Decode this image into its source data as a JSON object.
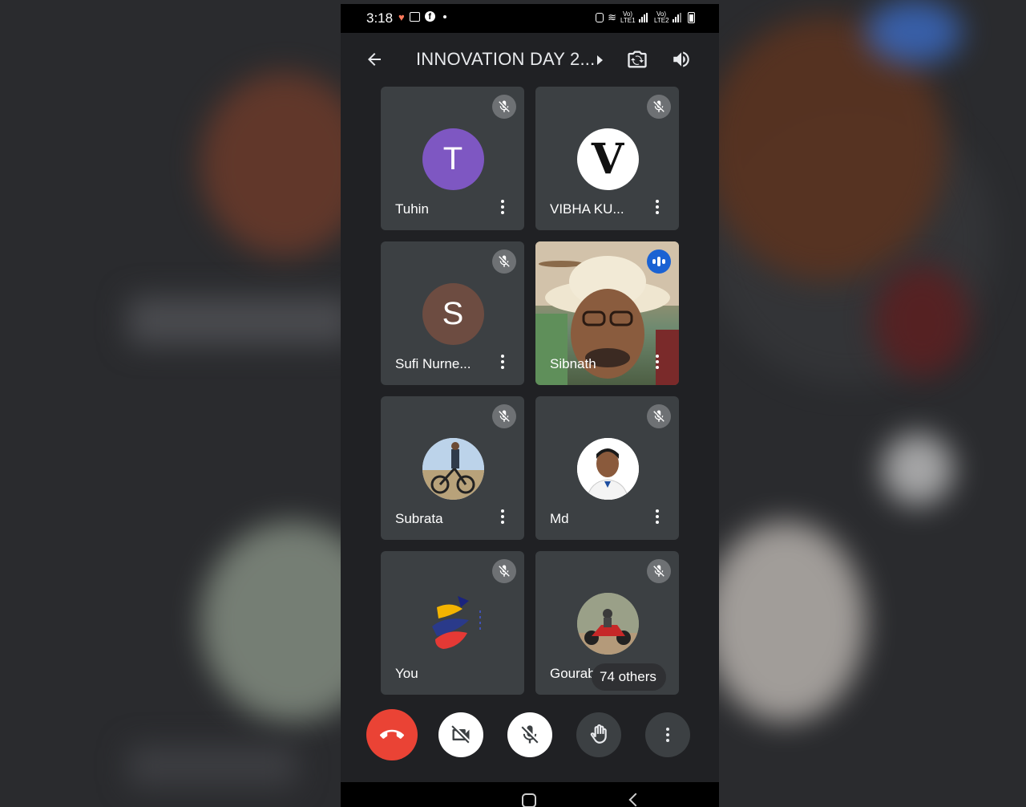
{
  "status_bar": {
    "time": "3:18",
    "left_icons": [
      "health-icon",
      "gallery-icon",
      "facebook-icon",
      "dot-icon"
    ],
    "lte1": "Vo) LTE1",
    "lte2": "Vo) LTE2"
  },
  "header": {
    "title": "INNOVATION DAY 2...",
    "back_icon": "arrow-left-icon",
    "flip_icon": "flip-camera-icon",
    "audio_icon": "speaker-icon"
  },
  "participants": [
    {
      "name": "Tuhin",
      "initial": "T",
      "avatar_color": "#7e57c2",
      "muted": true
    },
    {
      "name": "VIBHA KU...",
      "initial": "V",
      "avatar_color": "#ffffff",
      "muted": true
    },
    {
      "name": "Sufi Nurne...",
      "initial": "S",
      "avatar_color": "#6d4c41",
      "muted": true
    },
    {
      "name": "Sibnath",
      "video": true,
      "speaking": true
    },
    {
      "name": "Subrata",
      "photo": true,
      "muted": true
    },
    {
      "name": "Md",
      "photo": true,
      "muted": true
    },
    {
      "name": "You",
      "logo": true,
      "muted": true
    },
    {
      "name": "Gourab",
      "photo": true,
      "muted": true
    }
  ],
  "others_label": "74 others",
  "controls": {
    "end_call_color": "#ea4335",
    "buttons": [
      "end-call-icon",
      "camera-off-icon",
      "mic-off-icon",
      "raise-hand-icon",
      "more-vert-icon"
    ]
  }
}
